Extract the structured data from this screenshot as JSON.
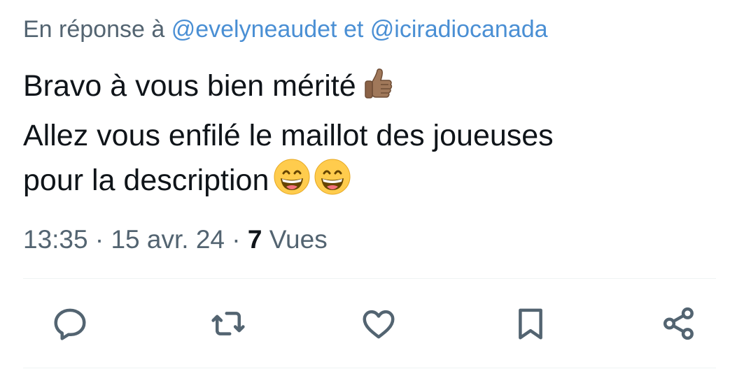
{
  "reply": {
    "prefix": "En réponse à",
    "mention1": "@evelyneaudet",
    "conjunction": "et",
    "mention2": "@iciradiocanada"
  },
  "tweet": {
    "line1": "Bravo à vous bien mérité",
    "line2": "Allez vous enfilé le maillot des joueuses",
    "line3": "pour la description",
    "emojis": [
      "thumbs-up-medium-skin",
      "grinning-face-smiling-eyes",
      "grinning-face-smiling-eyes"
    ]
  },
  "meta": {
    "time": "13:35",
    "separator": "·",
    "date": "15 avr. 24",
    "views_count": "7",
    "views_label": "Vues"
  },
  "actions": {
    "icons": [
      "reply-icon",
      "retweet-icon",
      "like-icon",
      "bookmark-icon",
      "share-icon"
    ]
  },
  "colors": {
    "text": "#0f1419",
    "secondary": "#536471",
    "link": "#4a8fd4",
    "divider": "#eff3f4"
  }
}
